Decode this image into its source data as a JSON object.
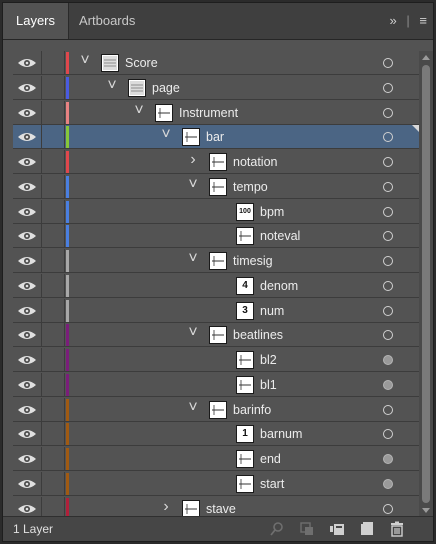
{
  "tabs": [
    {
      "label": "Layers"
    },
    {
      "label": "Artboards"
    }
  ],
  "menu": {
    "expand_label": "»",
    "divider": "|",
    "menu_label": "≡"
  },
  "footer": {
    "layer_count": "1 Layer"
  },
  "rows": [
    {
      "label": "Score",
      "color": "#e0474c",
      "depth": 0,
      "arrow": "down",
      "target": "empty"
    },
    {
      "label": "page",
      "color": "#4a5be0",
      "depth": 1,
      "arrow": "down",
      "target": "empty"
    },
    {
      "label": "Instrument",
      "color": "#e88282",
      "depth": 2,
      "arrow": "down",
      "target": "empty"
    },
    {
      "label": "bar",
      "color": "#86c73a",
      "depth": 3,
      "arrow": "down",
      "target": "empty",
      "selected": true
    },
    {
      "label": "notation",
      "color": "#e0474c",
      "depth": 4,
      "arrow": "right",
      "target": "empty"
    },
    {
      "label": "tempo",
      "color": "#4a7fe0",
      "depth": 4,
      "arrow": "down",
      "target": "empty"
    },
    {
      "label": "bpm",
      "color": "#4a7fe0",
      "depth": 5,
      "arrow": "none",
      "target": "empty",
      "thumb_text": "100"
    },
    {
      "label": "noteval",
      "color": "#4a7fe0",
      "depth": 5,
      "arrow": "none",
      "target": "empty"
    },
    {
      "label": "timesig",
      "color": "#a8a8a8",
      "depth": 4,
      "arrow": "down",
      "target": "empty"
    },
    {
      "label": "denom",
      "color": "#a8a8a8",
      "depth": 5,
      "arrow": "none",
      "target": "empty",
      "thumb_text": "4"
    },
    {
      "label": "num",
      "color": "#a8a8a8",
      "depth": 5,
      "arrow": "none",
      "target": "empty",
      "thumb_text": "3"
    },
    {
      "label": "beatlines",
      "color": "#7a1e7a",
      "depth": 4,
      "arrow": "down",
      "target": "empty"
    },
    {
      "label": "bl2",
      "color": "#7a1e7a",
      "depth": 5,
      "arrow": "none",
      "target": "filled"
    },
    {
      "label": "bl1",
      "color": "#7a1e7a",
      "depth": 5,
      "arrow": "none",
      "target": "filled"
    },
    {
      "label": "barinfo",
      "color": "#a05a12",
      "depth": 4,
      "arrow": "down",
      "target": "empty"
    },
    {
      "label": "barnum",
      "color": "#a05a12",
      "depth": 5,
      "arrow": "none",
      "target": "empty",
      "thumb_text": "1"
    },
    {
      "label": "end",
      "color": "#a05a12",
      "depth": 5,
      "arrow": "none",
      "target": "filled"
    },
    {
      "label": "start",
      "color": "#a05a12",
      "depth": 5,
      "arrow": "none",
      "target": "filled"
    },
    {
      "label": "stave",
      "color": "#b0203a",
      "depth": 3,
      "arrow": "right",
      "target": "empty"
    }
  ]
}
